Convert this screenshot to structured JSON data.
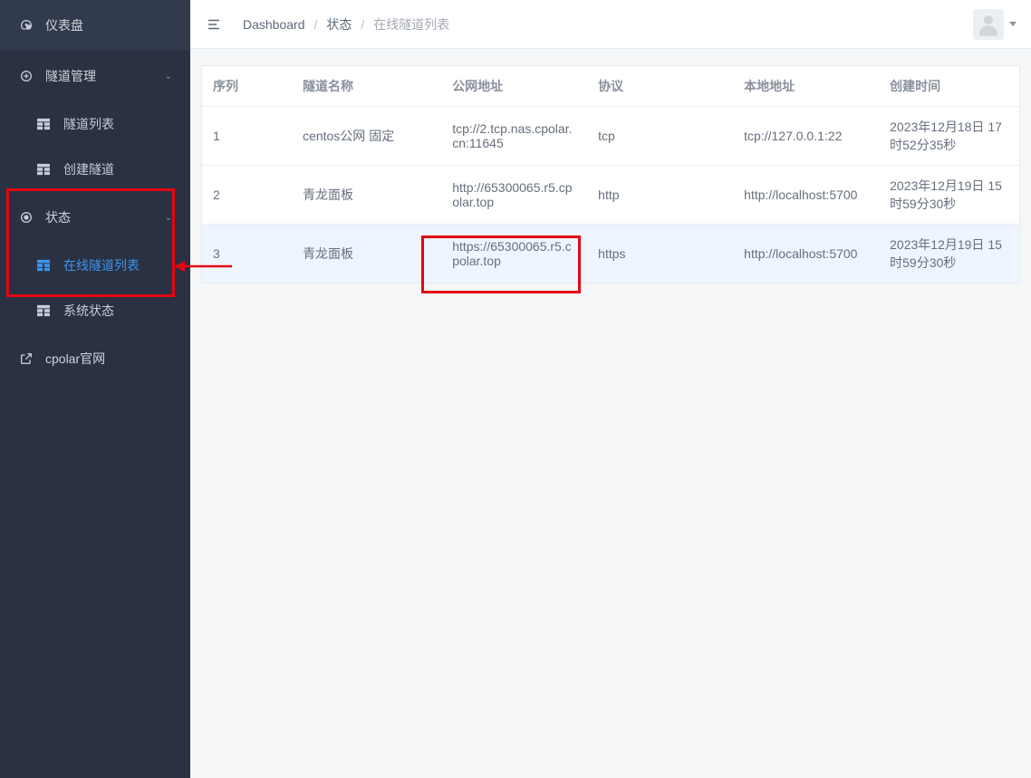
{
  "sidebar": {
    "items": [
      {
        "label": "仪表盘"
      },
      {
        "label": "隧道管理"
      },
      {
        "label": "状态"
      },
      {
        "label": "cpolar官网"
      }
    ],
    "tunnel_sub": [
      {
        "label": "隧道列表"
      },
      {
        "label": "创建隧道"
      }
    ],
    "status_sub": [
      {
        "label": "在线隧道列表"
      },
      {
        "label": "系统状态"
      }
    ]
  },
  "breadcrumb": {
    "a": "Dashboard",
    "b": "状态",
    "c": "在线隧道列表"
  },
  "table": {
    "headers": {
      "seq": "序列",
      "name": "隧道名称",
      "url": "公网地址",
      "proto": "协议",
      "local": "本地地址",
      "time": "创建时间"
    },
    "rows": [
      {
        "seq": "1",
        "name": "centos公网 固定",
        "url": "tcp://2.tcp.nas.cpolar.cn:11645",
        "proto": "tcp",
        "local": "tcp://127.0.0.1:22",
        "time": "2023年12月18日 17时52分35秒"
      },
      {
        "seq": "2",
        "name": "青龙面板",
        "url": "http://65300065.r5.cpolar.top",
        "proto": "http",
        "local": "http://localhost:5700",
        "time": "2023年12月19日 15时59分30秒"
      },
      {
        "seq": "3",
        "name": "青龙面板",
        "url": "https://65300065.r5.cpolar.top",
        "proto": "https",
        "local": "http://localhost:5700",
        "time": "2023年12月19日 15时59分30秒"
      }
    ]
  }
}
